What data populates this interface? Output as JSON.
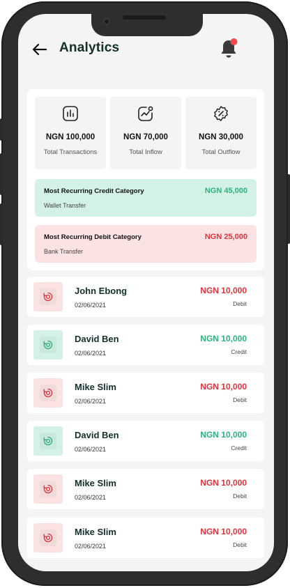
{
  "header": {
    "title": "Analytics"
  },
  "summary": {
    "stats": [
      {
        "amount": "NGN 100,000",
        "label": "Total Transactions",
        "icon": "bar-chart-icon"
      },
      {
        "amount": "NGN 70,000",
        "label": "Total Inflow",
        "icon": "trend-up-icon"
      },
      {
        "amount": "NGN 30,000",
        "label": "Total Outflow",
        "icon": "discount-badge-icon"
      }
    ],
    "credit_category": {
      "title": "Most Recurring Credit Category",
      "subtitle": "Wallet Transfer",
      "amount": "NGN 45,000"
    },
    "debit_category": {
      "title": "Most Recurring Debit Category",
      "subtitle": "Bank Transfer",
      "amount": "NGN 25,000"
    }
  },
  "transactions": [
    {
      "name": "John Ebong",
      "date": "02/06/2021",
      "amount": "NGN 10,000",
      "type": "Debit"
    },
    {
      "name": "David Ben",
      "date": "02/06/2021",
      "amount": "NGN 10,000",
      "type": "Credit"
    },
    {
      "name": "Mike Slim",
      "date": "02/06/2021",
      "amount": "NGN 10,000",
      "type": "Debit"
    },
    {
      "name": "David Ben",
      "date": "02/06/2021",
      "amount": "NGN 10,000",
      "type": "Credit"
    },
    {
      "name": "Mike Slim",
      "date": "02/06/2021",
      "amount": "NGN 10,000",
      "type": "Debit"
    },
    {
      "name": "Mike Slim",
      "date": "02/06/2021",
      "amount": "NGN 10,000",
      "type": "Debit"
    }
  ],
  "colors": {
    "credit": "#2cb37e",
    "debit": "#e0333c",
    "credit_bg": "#d3f2e5",
    "debit_bg": "#fbe3e3",
    "badge": "#ef4b4b",
    "title": "#12302a"
  }
}
